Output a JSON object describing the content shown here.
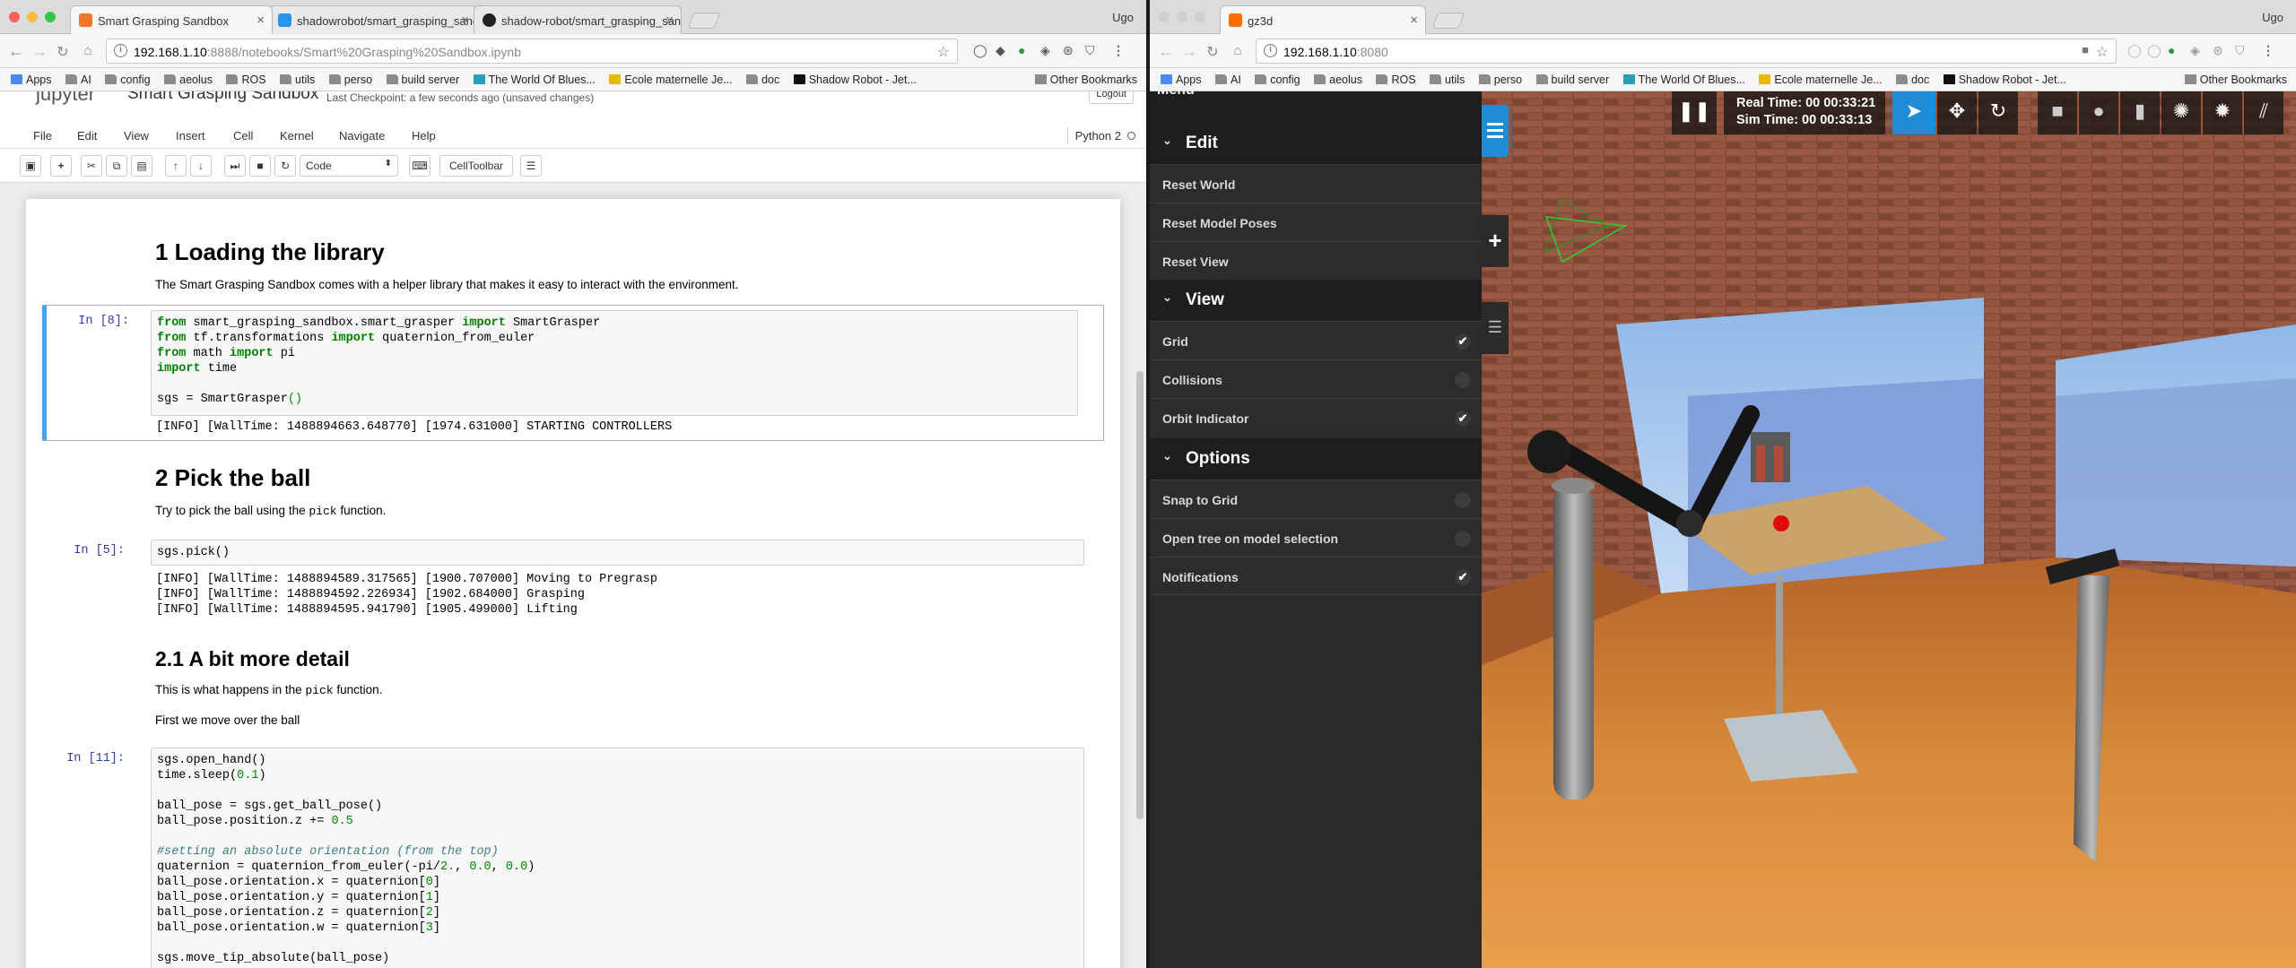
{
  "left_window": {
    "tabs": [
      {
        "title": "Smart Grasping Sandbox",
        "favicon_color": "#f37626"
      },
      {
        "title": "shadowrobot/smart_grasping_sandbox",
        "favicon_color": "#2496ed"
      },
      {
        "title": "shadow-robot/smart_grasping_sandbox",
        "favicon_color": "#222222"
      }
    ],
    "user": "Ugo",
    "url_host": "192.168.1.10",
    "url_path": ":8888/notebooks/Smart%20Grasping%20Sandbox.ipynb",
    "bookmarks": [
      "Apps",
      "AI",
      "config",
      "aeolus",
      "ROS",
      "utils",
      "perso",
      "build server",
      "The World Of Blues...",
      "Ecole maternelle Je...",
      "doc",
      "Shadow Robot - Jet..."
    ],
    "other_bookmarks": "Other Bookmarks",
    "jupyter": {
      "logo": "jupyter",
      "notebook_title": "Smart Grasping Sandbox",
      "checkpoint": "Last Checkpoint: a few seconds ago (unsaved changes)",
      "logout": "Logout",
      "menu": [
        "File",
        "Edit",
        "View",
        "Insert",
        "Cell",
        "Kernel",
        "Navigate",
        "Help"
      ],
      "kernel": "Python 2",
      "cell_type": "Code",
      "celltoolbar": "CellToolbar",
      "cells": {
        "h_loading": "1  Loading the library",
        "p_loading": "The Smart Grasping Sandbox comes with a helper library that makes it easy to interact with the environment.",
        "prompt8": "In [8]:",
        "out8": "[INFO] [WallTime: 1488894663.648770] [1974.631000] STARTING CONTROLLERS",
        "h_pick": "2  Pick the ball",
        "p_pick_a": "Try to pick the ball using the ",
        "p_pick_code": "pick",
        "p_pick_b": " function.",
        "prompt5": "In [5]:",
        "in5": "sgs.pick()",
        "out5": "[INFO] [WallTime: 1488894589.317565] [1900.707000] Moving to Pregrasp\n[INFO] [WallTime: 1488894592.226934] [1902.684000] Grasping\n[INFO] [WallTime: 1488894595.941790] [1905.499000] Lifting",
        "h_detail": "2.1  A bit more detail",
        "p_detail_a": "This is what happens in the ",
        "p_detail_code": "pick",
        "p_detail_b": " function.",
        "p_first": "First we move over the ball",
        "prompt11": "In [11]:"
      }
    }
  },
  "right_window": {
    "tab_title": "gz3d",
    "tab_favicon_color": "#ff6d00",
    "user": "Ugo",
    "url_host": "192.168.1.10",
    "url_path": ":8080",
    "menu_title": "Menu",
    "sections": [
      {
        "title": "Edit",
        "rows": [
          {
            "label": "Reset World"
          },
          {
            "label": "Reset Model Poses"
          },
          {
            "label": "Reset View"
          }
        ]
      },
      {
        "title": "View",
        "rows": [
          {
            "label": "Grid",
            "checked": true
          },
          {
            "label": "Collisions",
            "checked": false
          },
          {
            "label": "Orbit Indicator",
            "checked": true
          }
        ]
      },
      {
        "title": "Options",
        "rows": [
          {
            "label": "Snap to Grid",
            "checked": false
          },
          {
            "label": "Open tree on model selection",
            "checked": false
          },
          {
            "label": "Notifications",
            "checked": true
          }
        ]
      }
    ],
    "real_time": "Real Time: 00 00:33:21",
    "sim_time": "Sim Time: 00 00:33:13",
    "check_glyph": "✔",
    "icons": [
      "hamburger-icon",
      "plus-icon",
      "tree-icon",
      "pause-icon",
      "select-arrow-icon",
      "translate-icon",
      "rotate-icon",
      "box-icon",
      "sphere-icon",
      "cylinder-icon",
      "sun-icon",
      "spotlight-icon",
      "directional-light-icon"
    ]
  }
}
